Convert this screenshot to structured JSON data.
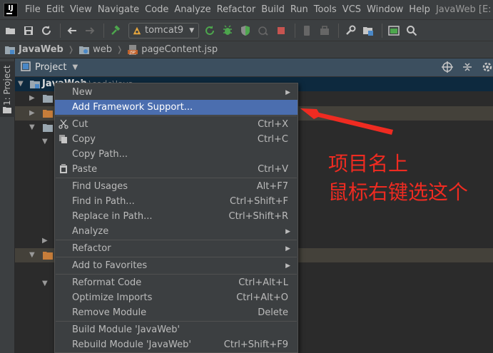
{
  "menubar": {
    "logo_text": "IJ",
    "items": [
      "File",
      "Edit",
      "View",
      "Navigate",
      "Code",
      "Analyze",
      "Refactor",
      "Build",
      "Run",
      "Tools",
      "VCS",
      "Window",
      "Help"
    ],
    "window_title": "JavaWeb [E:"
  },
  "toolbar": {
    "run_config": "tomcat9"
  },
  "breadcrumb": {
    "project": "JavaWeb",
    "folder": "web",
    "file": "pageContent.jsp",
    "file_icon_text": "JSP"
  },
  "side": {
    "tab_label": "1: Project"
  },
  "project_panel": {
    "title": "Project",
    "root_name": "JavaWeb",
    "root_path": "E:\\code\\Java..."
  },
  "context_menu": {
    "items": [
      {
        "label": "New",
        "shortcut": "",
        "submenu": true
      },
      {
        "label": "Add Framework Support...",
        "shortcut": "",
        "submenu": false
      },
      {
        "label": "Cut",
        "shortcut": "Ctrl+X",
        "submenu": false
      },
      {
        "label": "Copy",
        "shortcut": "Ctrl+C",
        "submenu": false
      },
      {
        "label": "Copy Path...",
        "shortcut": "",
        "submenu": false
      },
      {
        "label": "Paste",
        "shortcut": "Ctrl+V",
        "submenu": false
      },
      {
        "label": "Find Usages",
        "shortcut": "Alt+F7",
        "submenu": false
      },
      {
        "label": "Find in Path...",
        "shortcut": "Ctrl+Shift+F",
        "submenu": false
      },
      {
        "label": "Replace in Path...",
        "shortcut": "Ctrl+Shift+R",
        "submenu": false
      },
      {
        "label": "Analyze",
        "shortcut": "",
        "submenu": true
      },
      {
        "label": "Refactor",
        "shortcut": "",
        "submenu": true
      },
      {
        "label": "Add to Favorites",
        "shortcut": "",
        "submenu": true
      },
      {
        "label": "Reformat Code",
        "shortcut": "Ctrl+Alt+L",
        "submenu": false
      },
      {
        "label": "Optimize Imports",
        "shortcut": "Ctrl+Alt+O",
        "submenu": false
      },
      {
        "label": "Remove Module",
        "shortcut": "Delete",
        "submenu": false
      },
      {
        "label": "Build Module 'JavaWeb'",
        "shortcut": "",
        "submenu": false
      },
      {
        "label": "Rebuild Module 'JavaWeb'",
        "shortcut": "Ctrl+Shift+F9",
        "submenu": false
      }
    ]
  },
  "annotation": {
    "line1": "项目名上",
    "line2": "鼠标右键选这个",
    "color": "#ef2b21"
  },
  "colors": {
    "highlight": "#4b6eaf",
    "panel_header": "#3c4f5f",
    "background": "#2b2b2b"
  }
}
